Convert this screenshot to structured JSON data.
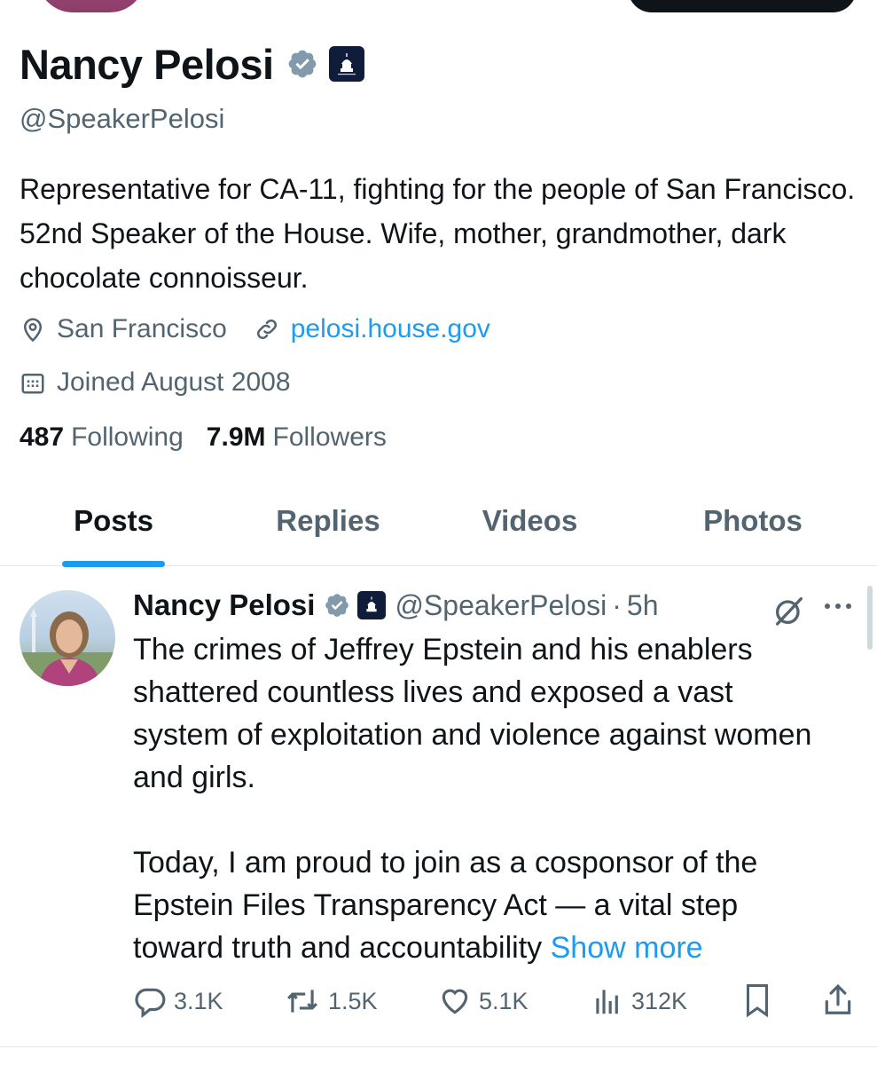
{
  "profile": {
    "display_name": "Nancy Pelosi",
    "handle": "@SpeakerPelosi",
    "bio": "Representative for CA-11, fighting for the people of San Francisco. 52nd Speaker of the House. Wife, mother, grandmother, dark chocolate connoisseur.",
    "location": "San Francisco",
    "website": "pelosi.house.gov",
    "joined": "Joined August 2008",
    "following_count": "487",
    "following_label": "Following",
    "followers_count": "7.9M",
    "followers_label": "Followers"
  },
  "tabs": [
    {
      "label": "Posts",
      "active": true
    },
    {
      "label": "Replies",
      "active": false
    },
    {
      "label": "Videos",
      "active": false
    },
    {
      "label": "Photos",
      "active": false
    }
  ],
  "post": {
    "author_name": "Nancy Pelosi",
    "author_handle": "@SpeakerPelosi",
    "separator": "·",
    "time": "5h",
    "paragraph1": "The crimes of Jeffrey Epstein and his enablers shattered countless lives and exposed a vast system of exploitation and violence against women and girls.",
    "paragraph2": "Today, I am proud to join as a cosponsor of the Epstein Files Transparency Act — a vital step toward truth and accountability",
    "show_more": "Show more",
    "replies": "3.1K",
    "reposts": "1.5K",
    "likes": "5.1K",
    "views": "312K"
  },
  "colors": {
    "accent": "#1d9bf0",
    "secondary_text": "#536471",
    "verified_badge": "#829aab",
    "affiliation_badge": "#0f1d3a"
  },
  "icons": [
    "verified-badge-icon",
    "capitol-affiliation-icon",
    "location-pin-icon",
    "link-icon",
    "calendar-icon",
    "grok-icon",
    "more-icon",
    "reply-icon",
    "repost-icon",
    "like-icon",
    "views-icon",
    "bookmark-icon",
    "share-icon"
  ]
}
